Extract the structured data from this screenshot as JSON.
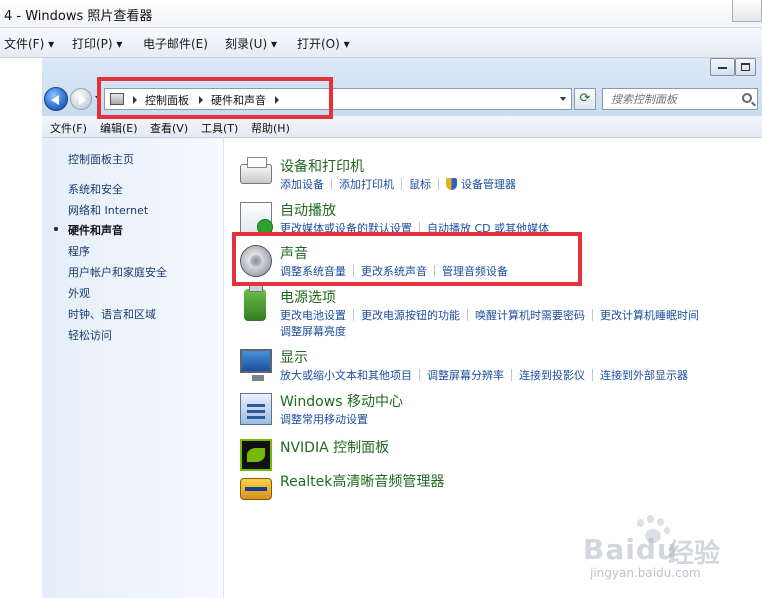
{
  "outer_window": {
    "title": "4 - Windows 照片查看器",
    "menu": [
      {
        "label": "文件(F)",
        "has_dropdown": true
      },
      {
        "label": "打印(P)",
        "has_dropdown": true
      },
      {
        "label": "电子邮件(E)",
        "has_dropdown": false
      },
      {
        "label": "刻录(U)",
        "has_dropdown": true
      },
      {
        "label": "打开(O)",
        "has_dropdown": true
      }
    ]
  },
  "address_bar": {
    "breadcrumbs": [
      "控制面板",
      "硬件和声音"
    ]
  },
  "search": {
    "placeholder": "搜索控制面板"
  },
  "cp_menu": [
    "文件(F)",
    "编辑(E)",
    "查看(V)",
    "工具(T)",
    "帮助(H)"
  ],
  "left_pane": {
    "home": "控制面板主页",
    "items": [
      {
        "label": "系统和安全",
        "current": false
      },
      {
        "label": "网络和 Internet",
        "current": false
      },
      {
        "label": "硬件和声音",
        "current": true
      },
      {
        "label": "程序",
        "current": false
      },
      {
        "label": "用户帐户和家庭安全",
        "current": false
      },
      {
        "label": "外观",
        "current": false
      },
      {
        "label": "时钟、语言和区域",
        "current": false
      },
      {
        "label": "轻松访问",
        "current": false
      }
    ]
  },
  "categories": [
    {
      "title": "设备和打印机",
      "icon": "printer-icon",
      "links": [
        "添加设备",
        "添加打印机",
        "鼠标",
        "设备管理器"
      ],
      "links2": []
    },
    {
      "title": "自动播放",
      "icon": "autoplay-icon",
      "links": [
        "更改媒体或设备的默认设置",
        "自动播放 CD 或其他媒体"
      ],
      "links2": []
    },
    {
      "title": "声音",
      "icon": "speaker-icon",
      "links": [
        "调整系统音量",
        "更改系统声音",
        "管理音频设备"
      ],
      "links2": []
    },
    {
      "title": "电源选项",
      "icon": "power-icon",
      "links": [
        "更改电池设置",
        "更改电源按钮的功能",
        "唤醒计算机时需要密码",
        "更改计算机睡眠时间"
      ],
      "links2": [
        "调整屏幕亮度"
      ]
    },
    {
      "title": "显示",
      "icon": "monitor-icon",
      "links": [
        "放大或缩小文本和其他项目",
        "调整屏幕分辨率",
        "连接到投影仪",
        "连接到外部显示器"
      ],
      "links2": []
    },
    {
      "title": "Windows 移动中心",
      "icon": "mobility-center-icon",
      "links": [
        "调整常用移动设置"
      ],
      "links2": []
    },
    {
      "title": "NVIDIA 控制面板",
      "icon": "nvidia-icon",
      "links": [],
      "links2": []
    },
    {
      "title": "Realtek高清晰音频管理器",
      "icon": "realtek-icon",
      "links": [],
      "links2": []
    }
  ],
  "watermark": {
    "brand": "Baidu",
    "suffix": "经验",
    "url": "jingyan.baidu.com"
  },
  "colors": {
    "annotation_red": "#e5313a",
    "category_title": "#1f6a1f",
    "link": "#1d4d9e"
  }
}
